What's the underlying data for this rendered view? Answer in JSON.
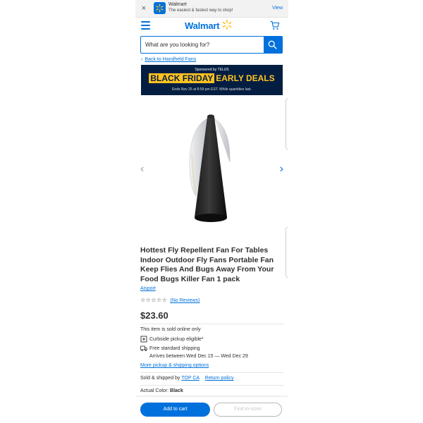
{
  "app_banner": {
    "close": "×",
    "name": "Walmart",
    "tagline": "The easiest & fastest way to shop!",
    "view": "View"
  },
  "header": {
    "logo": "Walmart"
  },
  "search": {
    "placeholder": "What are you looking for?"
  },
  "breadcrumb": {
    "arrow": "‹",
    "back": "Back to Handheld Fans"
  },
  "ad": {
    "sponsored": "Sponsored by TELUS",
    "black_friday": "BLACK FRIDAY",
    "early_deals": "EARLY DEALS",
    "ends": "Ends Nov 25 at 8:59 pm EST. While quantities last."
  },
  "gallery": {
    "prev": "‹",
    "next": "›"
  },
  "product": {
    "title": "Hottest Fly Repellent Fan For Tables Indoor Outdoor Fly Fans Portable Fan Keep Flies And Bugs Away From Your Food Bugs Killer Fan 1 pack",
    "brand": "Aisport",
    "stars": "☆☆☆☆☆",
    "reviews": "(No Reviews)",
    "price": "$23.60"
  },
  "fulfillment": {
    "online_only": "This item is sold online only",
    "curbside": "Curbside pickup eligible*",
    "shipping": "Free standard shipping",
    "arrives": "Arrives between Wed Dec 15 — Wed Dec 29",
    "more_options": "More pickup & shipping options"
  },
  "seller": {
    "sold_by_label": "Sold & shipped by",
    "seller_name": "TOP CA",
    "return_policy": "Return policy"
  },
  "color": {
    "label": "Actual Color:",
    "value": "Black"
  },
  "actions": {
    "add_to_cart": "Add to cart",
    "find_in_store": "Find in-store"
  },
  "colors": {
    "brand_blue": "#0071dc",
    "spark_yellow": "#ffc220",
    "ad_navy": "#041e42"
  }
}
